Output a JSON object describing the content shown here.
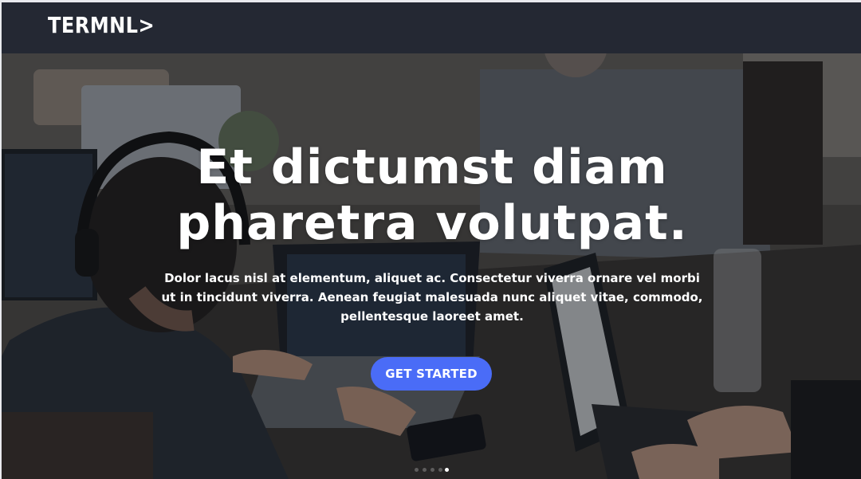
{
  "header": {
    "logo": "TERMNL>"
  },
  "hero": {
    "headline_line1": "Et dictumst diam",
    "headline_line2": "pharetra volutpat.",
    "subtext_line1": "Dolor lacus nisl at elementum, aliquet ac. Consectetur viverra ornare vel morbi",
    "subtext_line2": "ut in tincidunt viverra. Aenean feugiat malesuada nunc aliquet vitae, commodo,",
    "subtext_line3": "pellentesque laoreet amet.",
    "cta_label": "GET STARTED",
    "slider": {
      "count": 5,
      "active_index": 4
    }
  },
  "colors": {
    "header_bg": "#242833",
    "cta_bg": "#4a6cf7",
    "text": "#ffffff"
  }
}
